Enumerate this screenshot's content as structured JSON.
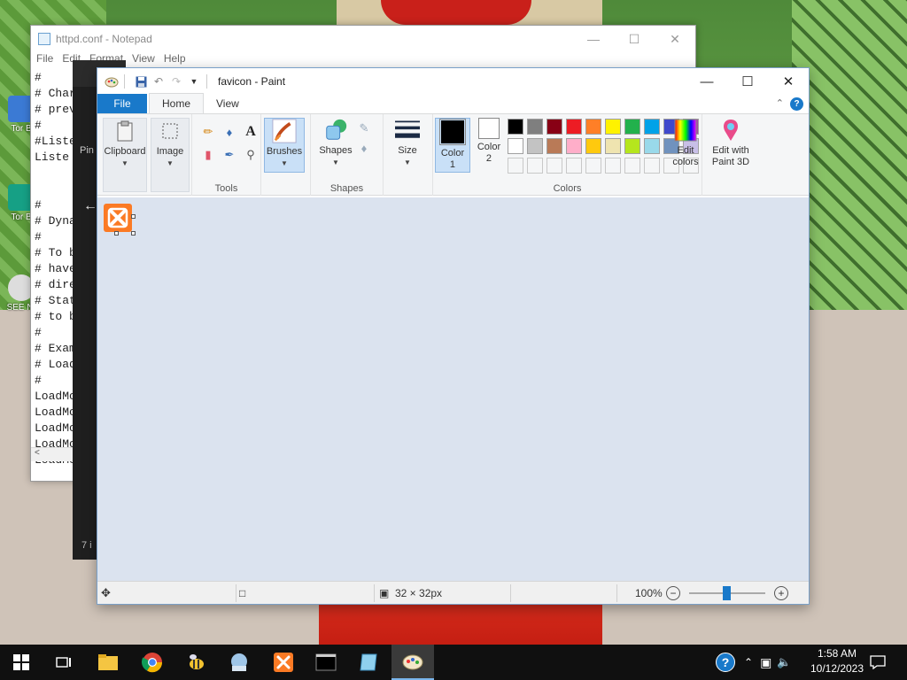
{
  "desktop": {
    "icons": [
      {
        "label": "Tor B",
        "color": "#3b7ad4"
      },
      {
        "label": "Tor B",
        "color": "#16a085"
      },
      {
        "label": "SEE NI",
        "color": "#dddddd"
      }
    ]
  },
  "notepad": {
    "title": "httpd.conf - Notepad",
    "menu": [
      "File",
      "Edit",
      "Format",
      "View",
      "Help"
    ],
    "lines": "#\n# Char\n# prev\n#\n#Liste\nListe\n\n\n#\n# Dyna\n#\n# To b\n# have\n# dire\n# Stat\n# to b\n#\n# Exam\n# Load\n#\nLoadMo\nLoadMo\nLoadMo\nLoadMo\nLoadMo",
    "scroll_left": "<"
  },
  "explorer": {
    "pin_label": "Pin a",
    "status": "7 i"
  },
  "paint": {
    "title": "favicon - Paint",
    "tabs": {
      "file": "File",
      "home": "Home",
      "view": "View"
    },
    "help": "?",
    "groups": {
      "clipboard": "Clipboard",
      "image": "Image",
      "tools": "Tools",
      "brushes": "Brushes",
      "shapes_btn": "Shapes",
      "shapes": "Shapes",
      "size": "Size",
      "color1": "Color\n1",
      "color2": "Color\n2",
      "colors": "Colors",
      "edit_colors": "Edit\ncolors",
      "edit_paint3d": "Edit with\nPaint 3D"
    },
    "palette_row1": [
      "#000000",
      "#7f7f7f",
      "#880015",
      "#ed1c24",
      "#ff7f27",
      "#fff200",
      "#22b14c",
      "#00a2e8",
      "#3f48cc",
      "#a349a4"
    ],
    "palette_row2": [
      "#ffffff",
      "#c3c3c3",
      "#b97a57",
      "#ffaec9",
      "#ffc90e",
      "#efe4b0",
      "#b5e61d",
      "#99d9ea",
      "#7092be",
      "#c8bfe7"
    ],
    "color1": "#000000",
    "color2": "#ffffff",
    "status": {
      "size": "32 × 32px",
      "zoom": "100%"
    }
  },
  "taskbar": {
    "clock_time": "1:58 AM",
    "clock_date": "10/12/2023"
  }
}
